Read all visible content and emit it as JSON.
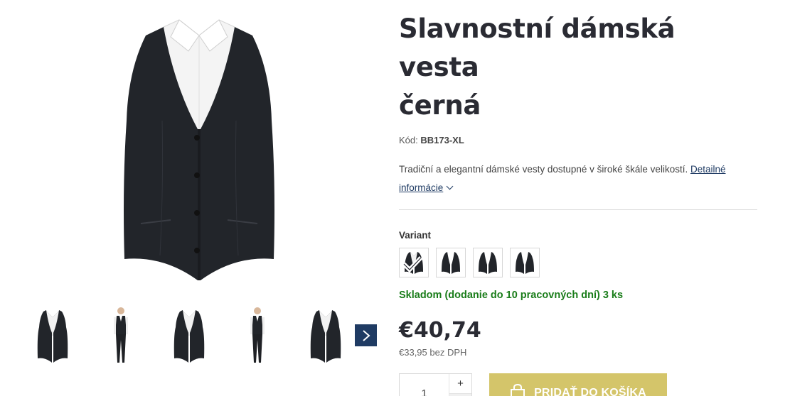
{
  "product": {
    "title_line1": "Slavnostní dámská vesta",
    "title_line2": "černá",
    "code_label": "Kód:",
    "code_value": "BB173-XL",
    "description": "Tradiční a elegantní dámské vesty dostupné v široké škále velikostí.",
    "details_link": "Detailné informácie",
    "variant_label": "Variant",
    "variants": [
      "vest-with-shirt",
      "vest-black",
      "vest-black",
      "vest-black"
    ],
    "selected_variant": 0,
    "stock": "Skladom (dodanie do 10 pracovných dní) 3 ks",
    "price": "€40,74",
    "price_net": "€33,95 bez DPH",
    "quantity": "1",
    "qty_plus": "+",
    "qty_minus": "-",
    "add_to_cart": "PRIDAŤ DO KOŠÍKA"
  },
  "gallery": {
    "thumbnails": [
      "vest",
      "full-outfit",
      "vest",
      "full-outfit",
      "vest"
    ],
    "next_icon": "chevron-right-icon"
  },
  "colors": {
    "accent_blue": "#1f3b63",
    "cart_button": "#d4c56a",
    "stock_green": "#1a7d1a"
  }
}
